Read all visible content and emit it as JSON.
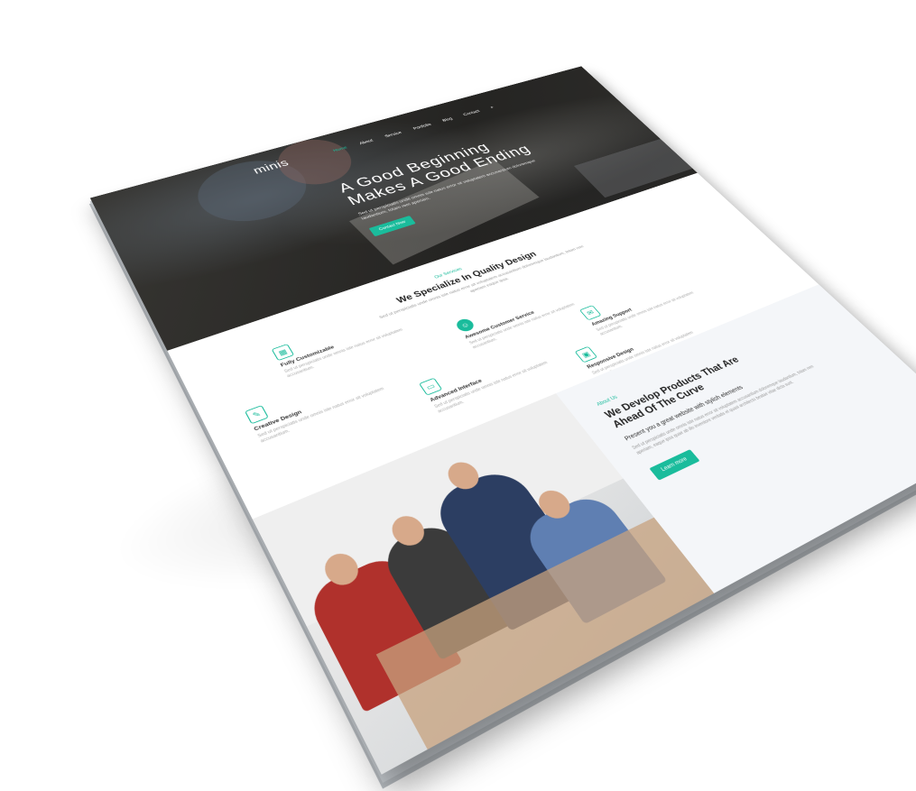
{
  "brand": {
    "logo": "minis",
    "accent": "#1abc9c"
  },
  "nav": {
    "items": [
      {
        "label": "Home"
      },
      {
        "label": "About"
      },
      {
        "label": "Service"
      },
      {
        "label": "Portfolio"
      },
      {
        "label": "Blog"
      },
      {
        "label": "Contact"
      }
    ],
    "active_index": 0,
    "search_icon": "search-icon"
  },
  "hero": {
    "title_line1": "A Good Beginning",
    "title_line2": "Makes A Good Ending",
    "subtitle": "Sed ut perspiciatis unde omnis iste natus error sit voluptatem accusantium doloremque laudantium, totam rem aperiam.",
    "button_label": "Contact Now"
  },
  "services": {
    "eyebrow": "Our Services",
    "title": "We Specialize In Quality Design",
    "description": "Sed ut perspiciatis unde omnis iste natus error sit voluptatem accusantium doloremque laudantium, totam rem aperiam eaque ipsa.",
    "items": [
      {
        "icon": "layers-icon",
        "title": "Fully Customizable",
        "desc": "Sed ut perspiciatis unde omnis iste natus error sit voluptatem accusantium."
      },
      {
        "icon": "support-icon",
        "title": "Awesome Customer Service",
        "desc": "Sed ut perspiciatis unde omnis iste natus error sit voluptatem accusantium."
      },
      {
        "icon": "brush-icon",
        "title": "Creative Design",
        "desc": "Sed ut perspiciatis unde omnis iste natus error sit voluptatem accusantium."
      },
      {
        "icon": "interface-icon",
        "title": "Advanced Interface",
        "desc": "Sed ut perspiciatis unde omnis iste natus error sit voluptatem accusantium."
      },
      {
        "icon": "chat-icon",
        "title": "Amazing Support",
        "desc": "Sed ut perspiciatis unde omnis iste natus error sit voluptatem accusantium."
      },
      {
        "icon": "monitor-icon",
        "title": "Responsive Design",
        "desc": "Sed ut perspiciatis unde omnis iste natus error sit voluptatem accusantium."
      }
    ]
  },
  "about": {
    "eyebrow": "About Us",
    "title_line1": "We Develop Products That Are",
    "title_line2": "Ahead Of The Curve",
    "lead": "Present you a great website with stylish elements",
    "body": "Sed ut perspiciatis unde omnis iste natus error sit voluptatem accusantium doloremque laudantium, totam rem aperiam, eaque ipsa quae ab illo inventore veritatis et quasi architecto beatae vitae dicta sunt.",
    "button_label": "Learn more"
  }
}
